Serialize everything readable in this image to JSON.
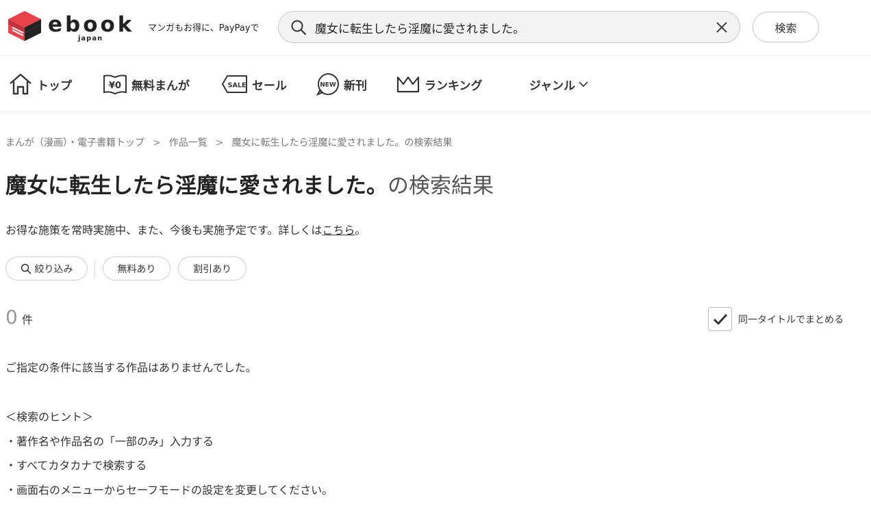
{
  "header": {
    "logo_text": "ebook",
    "logo_sub": "japan",
    "tagline": "マンガもお得に、PayPayで",
    "search_value": "魔女に転生したら淫魔に愛されました。",
    "search_button": "検索"
  },
  "nav": {
    "top": "トップ",
    "free": "無料まんが",
    "sale": "セール",
    "new": "新刊",
    "ranking": "ランキング",
    "genre": "ジャンル"
  },
  "breadcrumb": {
    "home": "まんが（漫画）・電子書籍トップ",
    "sep": ">",
    "list": "作品一覧",
    "current": "魔女に転生したら淫魔に愛されました。の検索結果"
  },
  "title": {
    "query": "魔女に転生したら淫魔に愛されました。",
    "suffix": "の検索結果"
  },
  "notice": {
    "text": "お得な施策を常時実施中、また、今後も実施予定です。詳しくは",
    "link": "こちら",
    "end": "。"
  },
  "filters": {
    "narrow": "絞り込み",
    "free": "無料あり",
    "discount": "割引あり"
  },
  "results": {
    "count": "0",
    "unit": "件",
    "group_label": "同一タイトルでまとめる",
    "group_checked": true
  },
  "empty_message": "ご指定の条件に該当する作品はありませんでした。",
  "hints": {
    "title": "＜検索のヒント＞",
    "items": [
      "・著作名や作品名の「一部のみ」入力する",
      "・すべてカタカナで検索する",
      "・画面右のメニューからセーフモードの設定を変更してください。"
    ]
  },
  "colors": {
    "brand": "#e8434a",
    "text": "#333333",
    "muted": "#999999"
  }
}
